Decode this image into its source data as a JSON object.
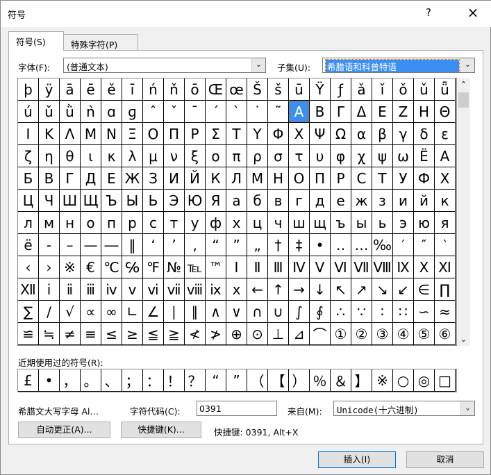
{
  "window": {
    "title": "符号",
    "help": "?",
    "close": "×"
  },
  "tabs": [
    {
      "label": "符号(S)"
    },
    {
      "label": "特殊字符(P)"
    }
  ],
  "font": {
    "label": "字体(F):",
    "value": "(普通文本)"
  },
  "subset": {
    "label": "子集(U):",
    "value": "希腊语和科普特语"
  },
  "grid": {
    "selected": [
      1,
      13
    ],
    "rows": [
      [
        "þ",
        "ÿ",
        "ā",
        "ē",
        "ě",
        "ī",
        "ń",
        "ň",
        "ō",
        "Œ",
        "œ",
        "Š",
        "š",
        "ū",
        "Ÿ",
        "ƒ",
        "ǎ",
        "ǐ",
        "ǒ",
        "ǔ",
        "ǖ"
      ],
      [
        "ú",
        "ǔ",
        "ǜ",
        "ǹ",
        "ɑ",
        "ɡ",
        "ˆ",
        "ˇ",
        "ˉ",
        "ˊ",
        "ˋ",
        "˙",
        "˜",
        "Α",
        "Β",
        "Γ",
        "Δ",
        "Ε",
        "Ζ",
        "Η",
        "Θ"
      ],
      [
        "Ι",
        "Κ",
        "Λ",
        "Μ",
        "Ν",
        "Ξ",
        "Ο",
        "Π",
        "Ρ",
        "Σ",
        "Τ",
        "Υ",
        "Φ",
        "Χ",
        "Ψ",
        "Ω",
        "α",
        "β",
        "γ",
        "δ",
        "ε"
      ],
      [
        "ζ",
        "η",
        "θ",
        "ι",
        "κ",
        "λ",
        "μ",
        "ν",
        "ξ",
        "ο",
        "π",
        "ρ",
        "σ",
        "τ",
        "υ",
        "φ",
        "χ",
        "ψ",
        "ω",
        "Ё",
        "А"
      ],
      [
        "Б",
        "В",
        "Г",
        "Д",
        "Е",
        "Ж",
        "З",
        "И",
        "Й",
        "К",
        "Л",
        "М",
        "Н",
        "О",
        "П",
        "Р",
        "С",
        "Т",
        "У",
        "Ф",
        "Х"
      ],
      [
        "Ц",
        "Ч",
        "Ш",
        "Щ",
        "Ъ",
        "Ы",
        "Ь",
        "Э",
        "Ю",
        "Я",
        "а",
        "б",
        "в",
        "г",
        "д",
        "е",
        "ж",
        "з",
        "и",
        "й",
        "к"
      ],
      [
        "л",
        "м",
        "н",
        "о",
        "п",
        "р",
        "с",
        "т",
        "у",
        "ф",
        "х",
        "ц",
        "ч",
        "ш",
        "щ",
        "ъ",
        "ы",
        "ь",
        "э",
        "ю",
        "я"
      ],
      [
        "ё",
        "‐",
        "–",
        "—",
        "―",
        "‖",
        "‘",
        "’",
        "‚",
        "“",
        "”",
        "„",
        "†",
        "‡",
        "•",
        "‥",
        "…",
        "‰",
        "′",
        "″",
        "‵"
      ],
      [
        "‹",
        "›",
        "※",
        "€",
        "℃",
        "℅",
        "℉",
        "№",
        "℡",
        "™",
        "Ⅰ",
        "Ⅱ",
        "Ⅲ",
        "Ⅳ",
        "Ⅴ",
        "Ⅵ",
        "Ⅶ",
        "Ⅷ",
        "Ⅸ",
        "Ⅹ",
        "Ⅺ"
      ],
      [
        "Ⅻ",
        "ⅰ",
        "ⅱ",
        "ⅲ",
        "ⅳ",
        "ⅴ",
        "ⅵ",
        "ⅶ",
        "ⅷ",
        "ⅸ",
        "ⅹ",
        "←",
        "↑",
        "→",
        "↓",
        "↖",
        "↗",
        "↘",
        "↙",
        "∈",
        "∏"
      ],
      [
        "∑",
        "∕",
        "√",
        "∝",
        "∞",
        "∟",
        "∠",
        "∣",
        "∥",
        "∧",
        "∨",
        "∩",
        "∪",
        "∫",
        "∮",
        "∴",
        "∵",
        "∶",
        "∷",
        "∽",
        "≈"
      ],
      [
        "≌",
        "≒",
        "≠",
        "≡",
        "≤",
        "≥",
        "≦",
        "≧",
        "≮",
        "≯",
        "⊕",
        "⊙",
        "⊥",
        "⊿",
        "⌒",
        "①",
        "②",
        "③",
        "④",
        "⑤",
        "⑥"
      ]
    ]
  },
  "recent": {
    "label": "近期使用过的符号(R):",
    "items": [
      "£",
      "•",
      "，",
      "。",
      "、",
      "；",
      "：",
      "！",
      "？",
      "“",
      "”",
      "（",
      "【",
      "）",
      "％",
      "＆",
      "】",
      "※",
      "○",
      "◎",
      "□"
    ]
  },
  "char_name": "希腊文大写字母 Al…",
  "char_code": {
    "label": "字符代码(C):",
    "value": "0391"
  },
  "from": {
    "label": "来自(M):",
    "value": "Unicode(十六进制)"
  },
  "autocorrect_button": "自动更正(A)...",
  "shortcut_button": "快捷键(K)...",
  "shortcut_text": "快捷键: 0391, Alt+X",
  "insert_button": "插入(I)",
  "cancel_button": "取消"
}
